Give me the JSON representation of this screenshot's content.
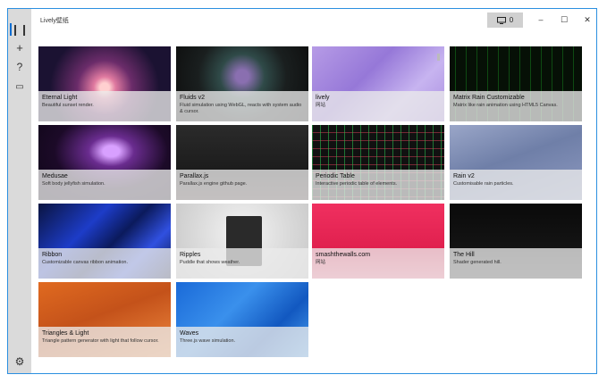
{
  "app": {
    "title": "Lively壁纸",
    "screens_count": "0"
  },
  "window_controls": {
    "minimize": "–",
    "maximize": "☐",
    "close": "✕"
  },
  "sidebar": {
    "items": [
      {
        "name": "library-icon",
        "glyph": "❙❙"
      },
      {
        "name": "add-icon",
        "glyph": "+"
      },
      {
        "name": "help-icon",
        "glyph": "?"
      },
      {
        "name": "chat-icon",
        "glyph": "▭"
      }
    ],
    "settings_glyph": "⚙"
  },
  "tiles": [
    {
      "title": "Eternal Light",
      "desc": "Beautiful sunset render."
    },
    {
      "title": "Fluids v2",
      "desc": "Fluid simulation using WebGL, reacts with system audio & cursor."
    },
    {
      "title": "lively",
      "desc": "网站"
    },
    {
      "title": "Matrix Rain Customizable",
      "desc": "Matrix like rain animation using HTML5 Canvas."
    },
    {
      "title": "Medusae",
      "desc": "Soft body jellyfish simulation."
    },
    {
      "title": "Parallax.js",
      "desc": "Parallax.js engine github page."
    },
    {
      "title": "Periodic Table",
      "desc": "Interactive periodic table of elements."
    },
    {
      "title": "Rain v2",
      "desc": "Customisable rain particles."
    },
    {
      "title": "Ribbon",
      "desc": "Customizable canvas ribbon animation."
    },
    {
      "title": "Ripples",
      "desc": "Puddle that shows weather."
    },
    {
      "title": "smashthewalls.com",
      "desc": "网站"
    },
    {
      "title": "The Hill",
      "desc": "Shader generated hill."
    },
    {
      "title": "Triangles & Light",
      "desc": "Triangle pattern generator with light that follow cursor."
    },
    {
      "title": "Waves",
      "desc": "Three.js wave simulation."
    }
  ]
}
